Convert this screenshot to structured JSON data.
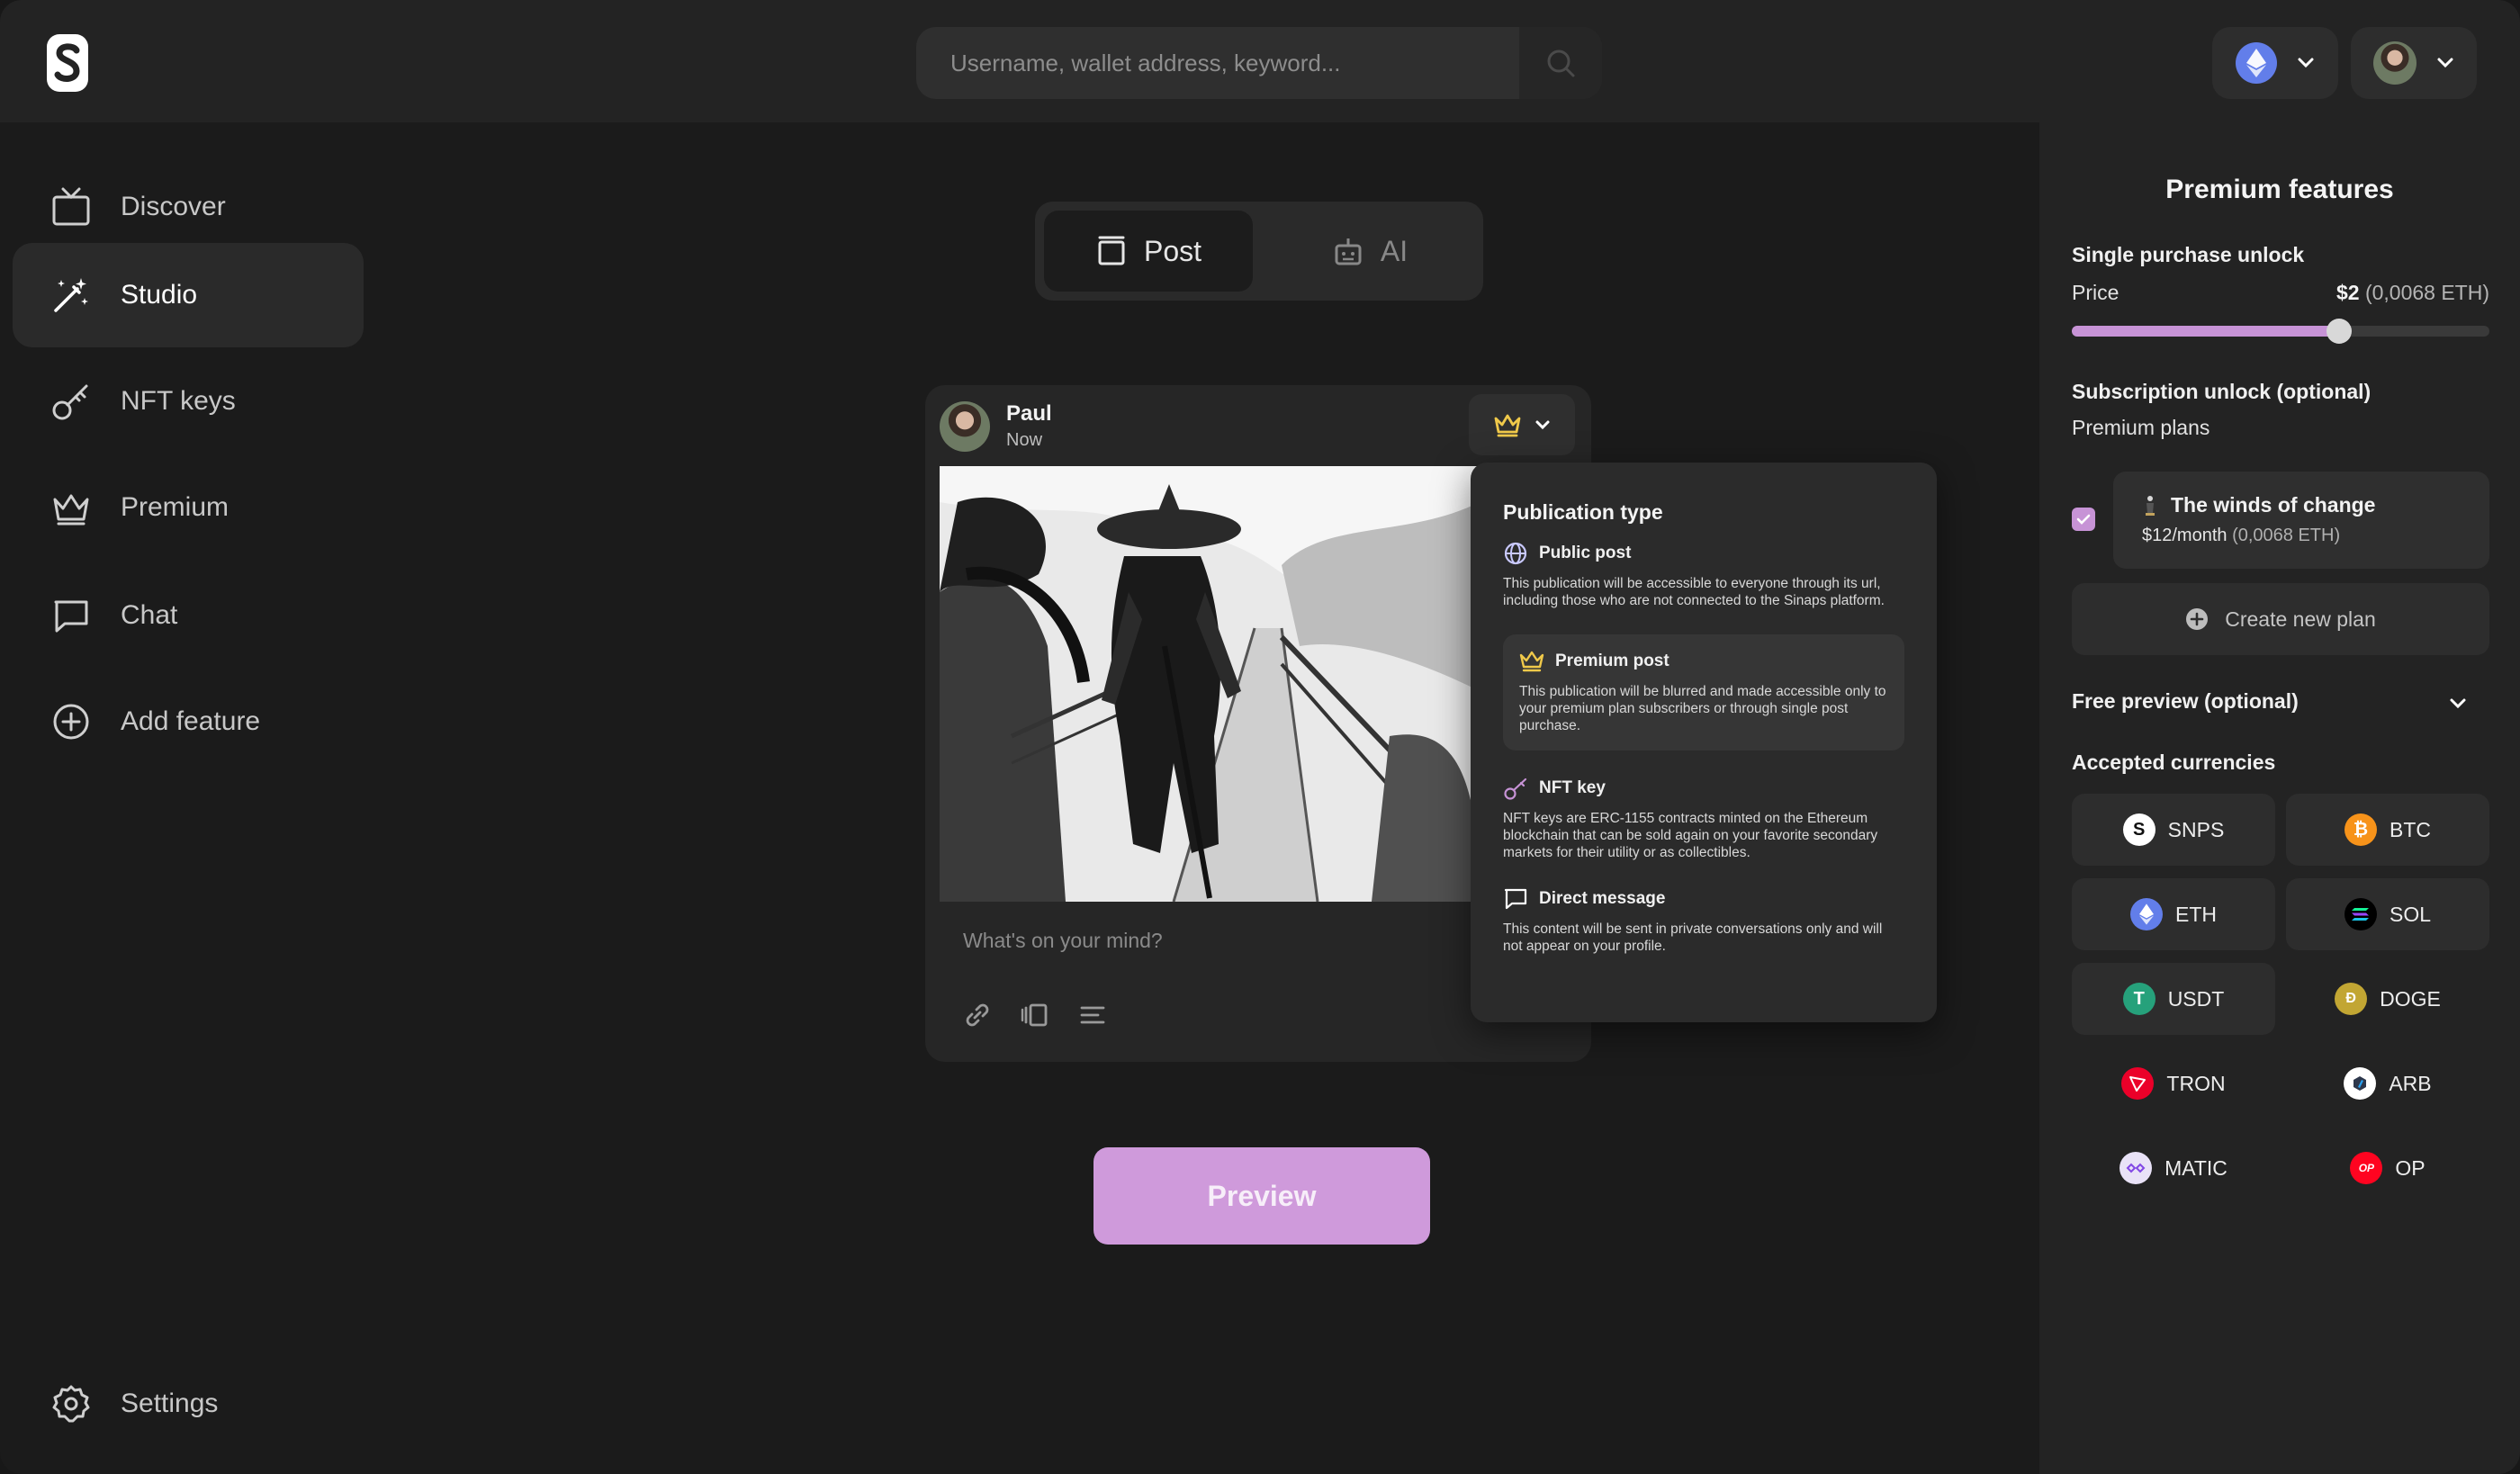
{
  "header": {
    "search_placeholder": "Username, wallet address, keyword..."
  },
  "sidebar": {
    "items": [
      {
        "label": "Discover"
      },
      {
        "label": "Studio"
      },
      {
        "label": "NFT keys"
      },
      {
        "label": "Premium"
      },
      {
        "label": "Chat"
      },
      {
        "label": "Add feature"
      }
    ],
    "settings_label": "Settings"
  },
  "editor": {
    "tabs": [
      {
        "label": "Post"
      },
      {
        "label": "AI"
      }
    ],
    "post": {
      "author": "Paul",
      "time": "Now",
      "placeholder": "What's on your mind?"
    },
    "preview_label": "Preview"
  },
  "publication_type": {
    "title": "Publication type",
    "options": [
      {
        "label": "Public post",
        "desc": "This publication will be accessible to everyone through its url, including those who are not connected to the Sinaps platform."
      },
      {
        "label": "Premium post",
        "desc": "This publication will be blurred and made accessible only to your premium plan subscribers or through single post purchase."
      },
      {
        "label": "NFT key",
        "desc": "NFT keys are ERC-1155 contracts minted on the Ethereum blockchain that can be sold again on your favorite secondary markets for their utility or as collectibles."
      },
      {
        "label": "Direct message",
        "desc": "This content will be sent in private conversations only and will not appear on your profile."
      }
    ]
  },
  "premium": {
    "title": "Premium features",
    "single_purchase_title": "Single purchase unlock",
    "price_label": "Price",
    "price_value": "$2",
    "price_eth": "(0,0068 ETH)",
    "price_slider_fraction": 0.64,
    "subscription_title": "Subscription unlock (optional)",
    "plans_label": "Premium plans",
    "plan": {
      "name": "The winds of change",
      "price": "$12/month",
      "price_eth": "(0,0068 ETH)",
      "checked": true
    },
    "create_plan_label": "Create new plan",
    "free_preview_label": "Free preview (optional)",
    "currencies_title": "Accepted currencies",
    "currencies": [
      {
        "label": "SNPS"
      },
      {
        "label": "BTC"
      },
      {
        "label": "ETH"
      },
      {
        "label": "SOL"
      },
      {
        "label": "USDT"
      },
      {
        "label": "DOGE"
      },
      {
        "label": "TRON"
      },
      {
        "label": "ARB"
      },
      {
        "label": "MATIC"
      },
      {
        "label": "OP"
      }
    ]
  },
  "colors": {
    "accent": "#cf9adb",
    "eth": "#627eea",
    "btc": "#f7931a",
    "usdt": "#26a17b",
    "tron": "#eb0029",
    "op": "#ff0420",
    "crown": "#f0c94a"
  }
}
